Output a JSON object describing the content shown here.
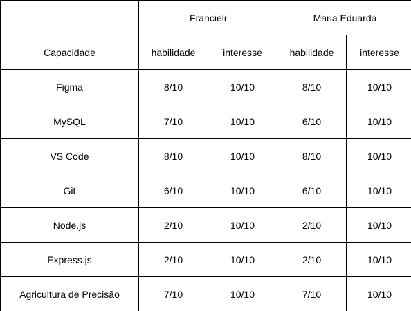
{
  "people": [
    "Francieli",
    "Maria Eduarda"
  ],
  "header": {
    "capacidade": "Capacidade",
    "sub": [
      "habilidade",
      "interesse",
      "habilidade",
      "interesse"
    ]
  },
  "rows": [
    {
      "capacidade": "Figma",
      "values": [
        "8/10",
        "10/10",
        "8/10",
        "10/10"
      ]
    },
    {
      "capacidade": "MySQL",
      "values": [
        "7/10",
        "10/10",
        "6/10",
        "10/10"
      ]
    },
    {
      "capacidade": "VS Code",
      "values": [
        "8/10",
        "10/10",
        "8/10",
        "10/10"
      ]
    },
    {
      "capacidade": "Git",
      "values": [
        "6/10",
        "10/10",
        "6/10",
        "10/10"
      ]
    },
    {
      "capacidade": "Node.js",
      "values": [
        "2/10",
        "10/10",
        "2/10",
        "10/10"
      ]
    },
    {
      "capacidade": "Express.js",
      "values": [
        "2/10",
        "10/10",
        "2/10",
        "10/10"
      ]
    },
    {
      "capacidade": "Agricultura de Precisão",
      "values": [
        "7/10",
        "10/10",
        "7/10",
        "10/10"
      ]
    }
  ]
}
